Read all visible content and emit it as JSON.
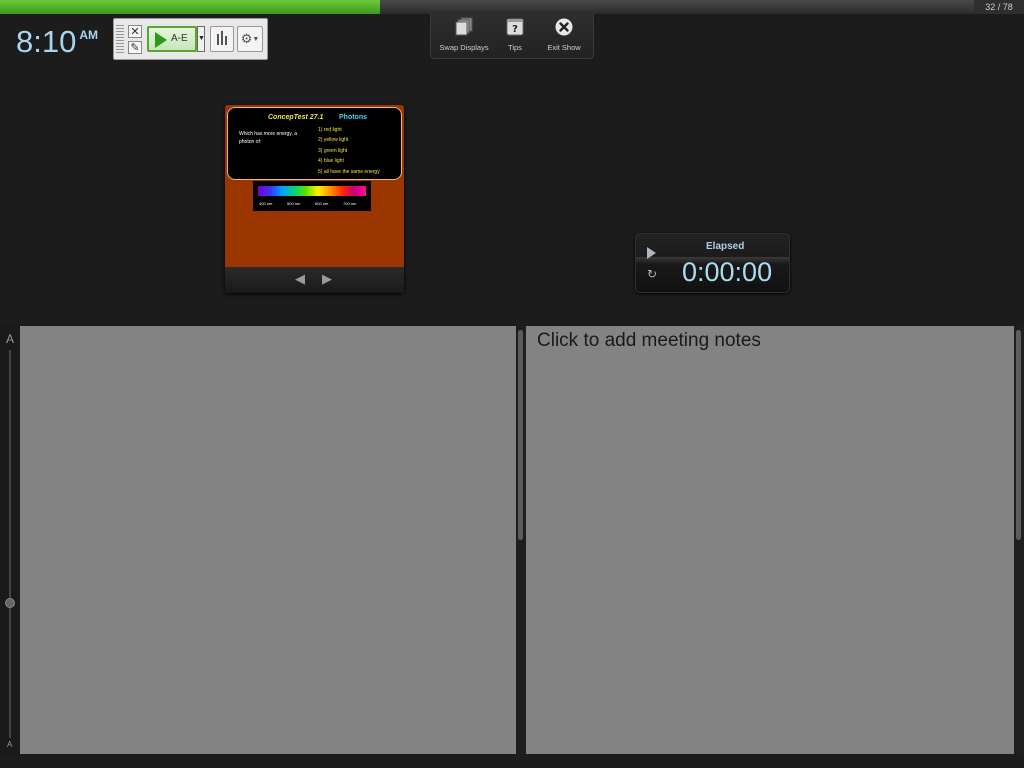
{
  "progress": {
    "current": 32,
    "total": 78,
    "fraction": 0.39,
    "label": "32 / 78",
    "color": "#5cbc2e"
  },
  "clock": {
    "time": "8:10",
    "ampm": "AM"
  },
  "clicker_toolbar": {
    "start_poll_label": "A-E",
    "icons": {
      "grip": "drag-grip-icon",
      "close": "close-poll-icon",
      "edit": "edit-poll-icon",
      "play": "play-icon",
      "dropdown": "chevron-down-icon",
      "chart": "bar-chart-icon",
      "settings": "gear-icon"
    }
  },
  "show_controls": {
    "swap_label": "Swap Displays",
    "tips_label": "Tips",
    "exit_label": "Exit Show"
  },
  "slide": {
    "title": "ConcepTest 27.1",
    "topic": "Photons",
    "question": "Which has more energy, a photon of:",
    "options": [
      "1)  red light",
      "2)  yellow light",
      "3)  green light",
      "4)  blue light",
      "5)  all have the same energy"
    ],
    "spectrum_labels": [
      "400 nm",
      "500 nm",
      "600 nm",
      "700 nm"
    ],
    "background_color": "#9b3600",
    "title_color": "#f6e44a",
    "topic_color": "#4ad2f2"
  },
  "slide_nav": {
    "prev_icon": "arrow-left-icon",
    "next_icon": "arrow-right-icon"
  },
  "timer": {
    "label": "Elapsed",
    "value": "0:00:00",
    "play_icon": "play-icon",
    "reset_icon": "reset-icon"
  },
  "font_scale": {
    "large_label": "A",
    "small_label": "A"
  },
  "meeting_notes": {
    "placeholder": "Click to add meeting notes"
  }
}
